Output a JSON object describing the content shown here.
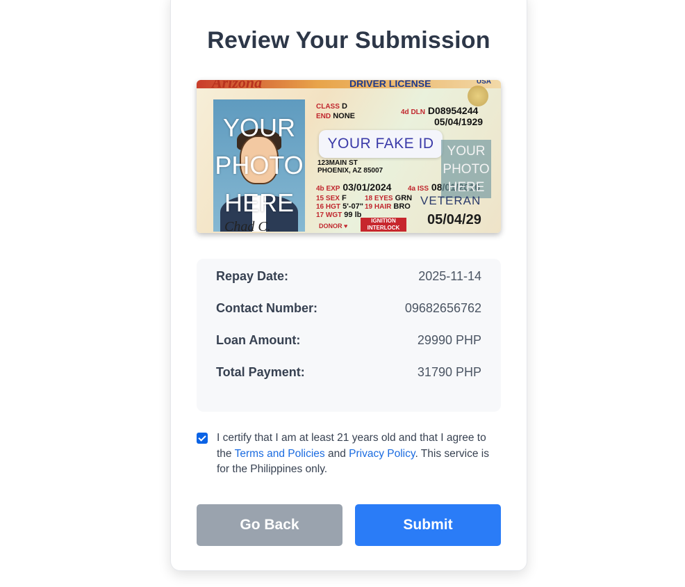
{
  "page": {
    "title": "Review Your Submission"
  },
  "id_card": {
    "state": "Arizona",
    "type": "DRIVER LICENSE",
    "country": "USA",
    "photo_text": "YOUR PHOTO HERE",
    "banner": "YOUR FAKE ID",
    "ghost_photo_text": "YOUR PHOTO HERE",
    "class_label": "CLASS",
    "class_value": "D",
    "end_label": "END",
    "end_value": "NONE",
    "dln_label": "4d DLN",
    "dln_value": "D08954244",
    "dob_value": "05/04/1929",
    "address_line1": "123MAIN ST",
    "address_line2": "PHOENIX, AZ 85007",
    "exp_label": "4b EXP",
    "exp_value": "03/01/2024",
    "iss_label": "4a ISS",
    "iss_value": "08/01/2016",
    "sex_label": "15 SEX",
    "sex_value": "F",
    "hgt_label": "16 HGT",
    "hgt_value": "5'-07\"",
    "wgt_label": "17 WGT",
    "wgt_value": "99 lb",
    "eyes_label": "18 EYES",
    "eyes_value": "GRN",
    "hair_label": "19 HAIR",
    "hair_value": "BRO",
    "veteran": "VETERAN",
    "date_large": "05/04/29",
    "interlock": "IGNITION INTERLOCK",
    "donor": "DONOR ♥",
    "signature": "Chad C."
  },
  "details": {
    "repay_label": "Repay Date:",
    "repay_value": "2025-11-14",
    "contact_label": "Contact Number:",
    "contact_value": "09682656762",
    "loan_label": "Loan Amount:",
    "loan_value": "29990 PHP",
    "total_label": "Total Payment:",
    "total_value": "31790 PHP"
  },
  "certify": {
    "checked": true,
    "text_before": "I certify that I am at least 21 years old and that I agree to the ",
    "terms_link": "Terms and Policies",
    "text_middle": " and ",
    "privacy_link": "Privacy Policy",
    "text_after": ". This service is for the Philippines only."
  },
  "buttons": {
    "back": "Go Back",
    "submit": "Submit"
  },
  "colors": {
    "accent": "#2a7cf7",
    "secondary_button": "#9aa3ae",
    "link": "#1a6be0",
    "title": "#2d3748"
  }
}
